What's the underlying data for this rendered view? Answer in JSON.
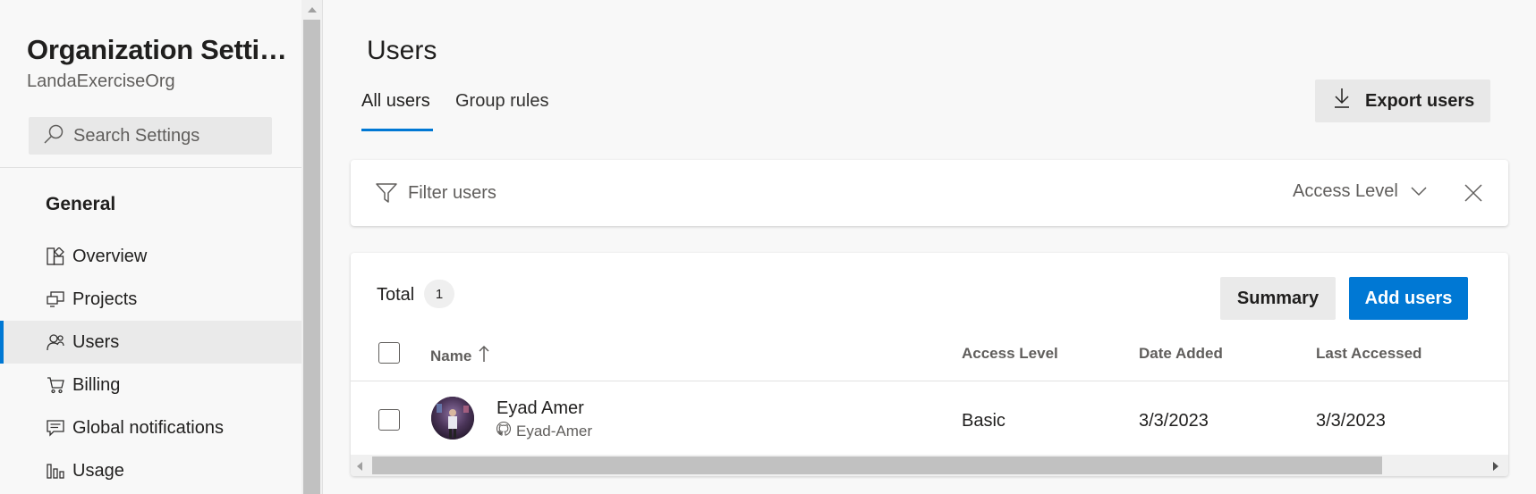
{
  "sidebar": {
    "title": "Organization Settin...",
    "org_name": "LandaExerciseOrg",
    "search_placeholder": "Search Settings",
    "group_label": "General",
    "items": [
      {
        "label": "Overview",
        "icon": "overview-icon",
        "active": false
      },
      {
        "label": "Projects",
        "icon": "projects-icon",
        "active": false
      },
      {
        "label": "Users",
        "icon": "users-icon",
        "active": true
      },
      {
        "label": "Billing",
        "icon": "cart-icon",
        "active": false
      },
      {
        "label": "Global notifications",
        "icon": "notifications-icon",
        "active": false
      },
      {
        "label": "Usage",
        "icon": "usage-icon",
        "active": false
      }
    ]
  },
  "main": {
    "title": "Users",
    "tabs": [
      {
        "label": "All users",
        "active": true
      },
      {
        "label": "Group rules",
        "active": false
      }
    ],
    "export_label": "Export users",
    "filter": {
      "placeholder": "Filter users",
      "dropdown_label": "Access Level"
    },
    "table": {
      "total_label": "Total",
      "total_count": "1",
      "summary_label": "Summary",
      "add_users_label": "Add users",
      "columns": [
        "Name",
        "Access Level",
        "Date Added",
        "Last Accessed"
      ],
      "rows": [
        {
          "name": "Eyad Amer",
          "github": "Eyad-Amer",
          "access_level": "Basic",
          "date_added": "3/3/2023",
          "last_accessed": "3/3/2023"
        }
      ]
    }
  },
  "colors": {
    "accent": "#0078d4",
    "background": "#f8f8f8",
    "card": "#ffffff"
  }
}
